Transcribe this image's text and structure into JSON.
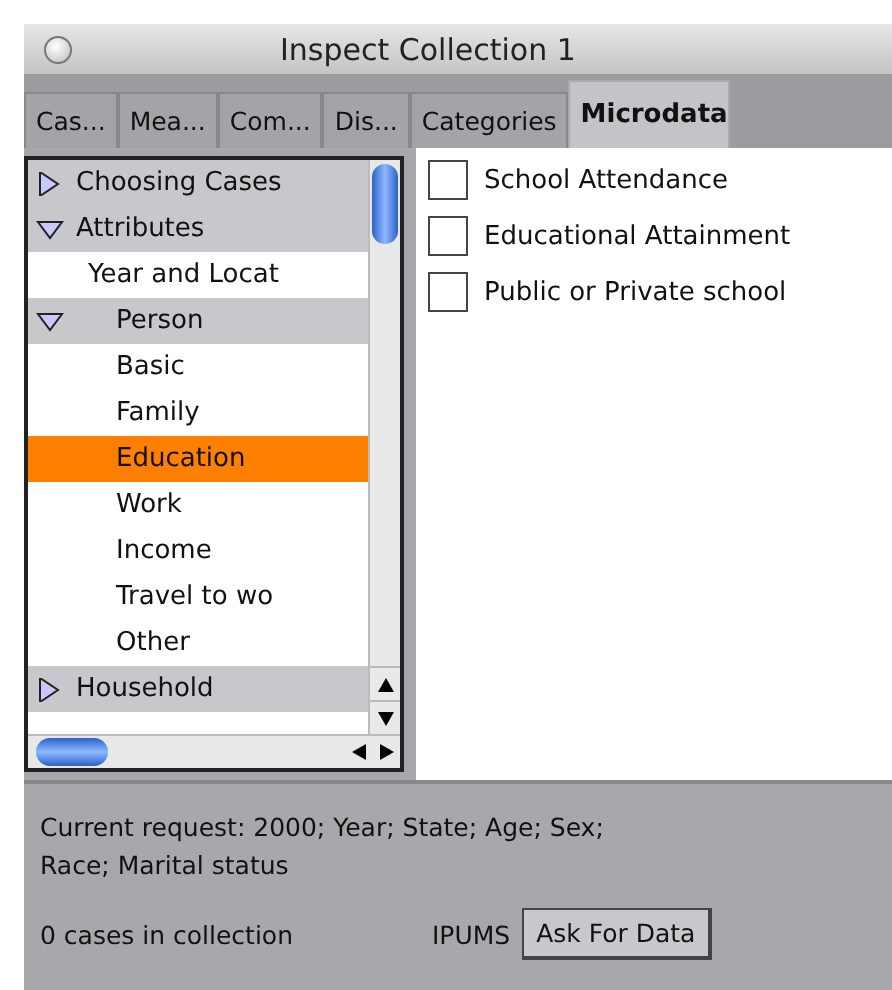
{
  "window": {
    "title": "Inspect Collection 1"
  },
  "tabs": [
    {
      "label": "Cas...",
      "selected": false
    },
    {
      "label": "Mea...",
      "selected": false
    },
    {
      "label": "Com...",
      "selected": false
    },
    {
      "label": "Dis...",
      "selected": false
    },
    {
      "label": "Categories",
      "selected": false
    },
    {
      "label": "Microdata",
      "selected": true
    }
  ],
  "tree": [
    {
      "label": "Choosing Cases",
      "kind": "group",
      "expanded": false,
      "selected": false
    },
    {
      "label": "Attributes",
      "kind": "group",
      "expanded": true,
      "selected": false,
      "children": [
        {
          "label": "Year and Locat",
          "kind": "item",
          "selected": false
        },
        {
          "label": "Person",
          "kind": "group",
          "expanded": true,
          "selected": false,
          "children": [
            {
              "label": "Basic",
              "kind": "item",
              "selected": false
            },
            {
              "label": "Family",
              "kind": "item",
              "selected": false
            },
            {
              "label": "Education",
              "kind": "item",
              "selected": true
            },
            {
              "label": "Work",
              "kind": "item",
              "selected": false
            },
            {
              "label": "Income",
              "kind": "item",
              "selected": false
            },
            {
              "label": "Travel to wo",
              "kind": "item",
              "selected": false
            },
            {
              "label": "Other",
              "kind": "item",
              "selected": false
            }
          ]
        }
      ]
    },
    {
      "label": "Household",
      "kind": "group",
      "expanded": false,
      "selected": false
    }
  ],
  "options": [
    {
      "label": "School Attendance",
      "checked": false
    },
    {
      "label": "Educational Attainment",
      "checked": false
    },
    {
      "label": "Public or Private school",
      "checked": false
    }
  ],
  "status": {
    "request": "Current request: 2000; Year; State; Age; Sex; Race; Marital status",
    "count": "0 cases in collection",
    "source": "IPUMS",
    "button": "Ask For Data"
  }
}
